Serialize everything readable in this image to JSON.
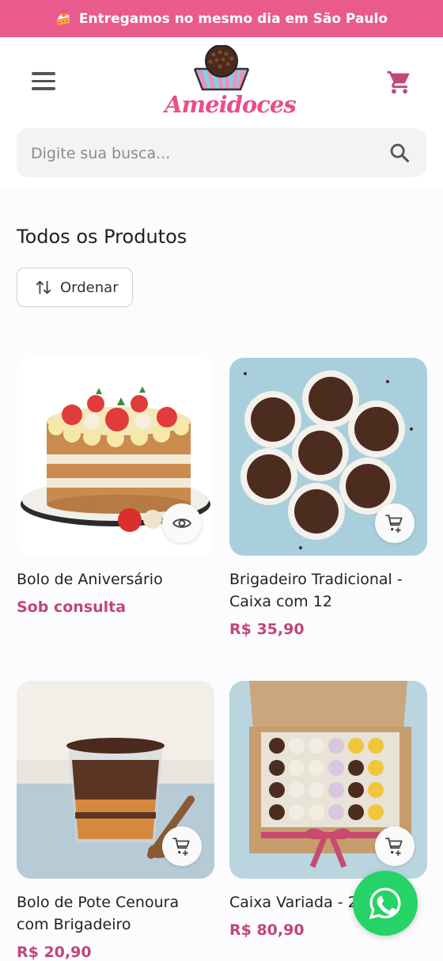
{
  "banner": {
    "text": "Entregamos no mesmo dia em São Paulo",
    "icon": "cake-icon"
  },
  "header": {
    "brand": "Ameidoces",
    "menu_icon": "hamburger-icon",
    "cart_icon": "cart-icon"
  },
  "search": {
    "placeholder": "Digite sua busca..."
  },
  "page": {
    "title": "Todos os Produtos",
    "sort_label": "Ordenar"
  },
  "products": [
    {
      "name": "Bolo de Aniversário",
      "price": "Sob consulta",
      "action": "eye-icon"
    },
    {
      "name": "Brigadeiro Tradicional - Caixa com 12",
      "price": "R$ 35,90",
      "action": "add-cart-icon"
    },
    {
      "name": "Bolo de Pote Cenoura com Brigadeiro",
      "price": "R$ 20,90",
      "action": "add-cart-icon"
    },
    {
      "name": "Caixa Variada - 24 Doces",
      "price": "R$ 80,90",
      "action": "add-cart-icon"
    }
  ],
  "colors": {
    "brand_pink": "#e95b8d",
    "price_pink": "#c0467b",
    "whatsapp_green": "#25d366"
  }
}
